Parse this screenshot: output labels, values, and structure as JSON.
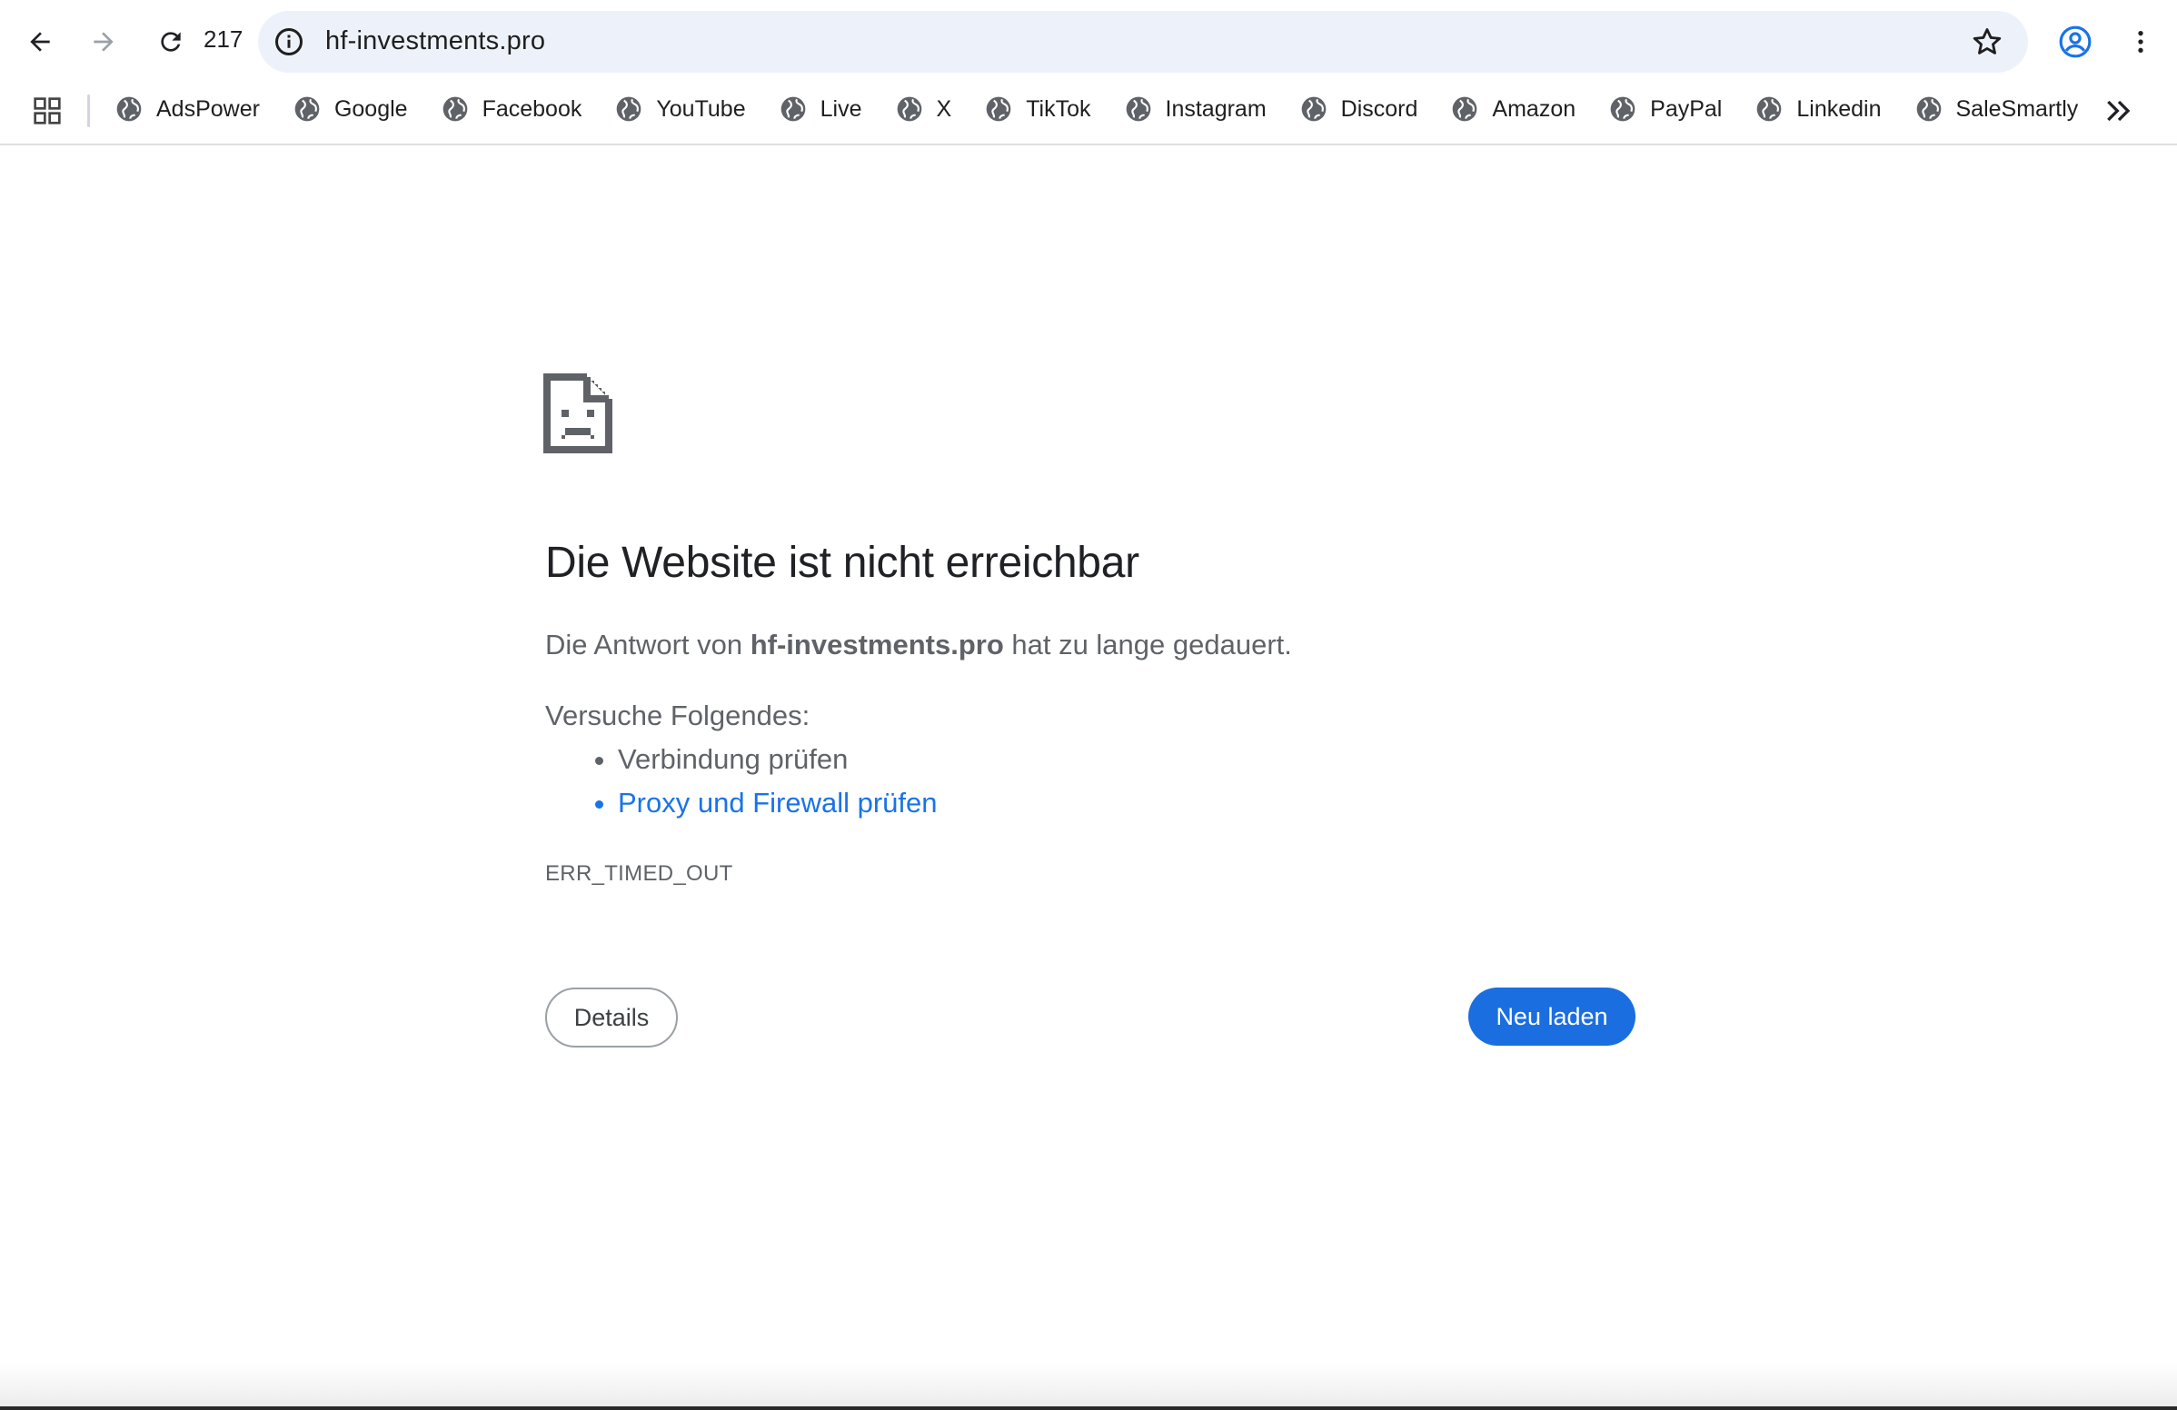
{
  "browser": {
    "tab_count": "217",
    "url": "hf-investments.pro",
    "icons": {
      "back": "back-arrow-icon",
      "forward": "forward-arrow-icon",
      "reload": "reload-icon",
      "site_info": "info-icon",
      "bookmark": "star-icon",
      "profile": "profile-icon",
      "menu": "kebab-menu-icon"
    }
  },
  "bookmarks": {
    "items": [
      {
        "label": "AdsPower"
      },
      {
        "label": "Google"
      },
      {
        "label": "Facebook"
      },
      {
        "label": "YouTube"
      },
      {
        "label": "Live"
      },
      {
        "label": "X"
      },
      {
        "label": "TikTok"
      },
      {
        "label": "Instagram"
      },
      {
        "label": "Discord"
      },
      {
        "label": "Amazon"
      },
      {
        "label": "PayPal"
      },
      {
        "label": "Linkedin"
      },
      {
        "label": "SaleSmartly"
      }
    ]
  },
  "error": {
    "title": "Die Website ist nicht erreichbar",
    "text_prefix": "Die Antwort von ",
    "host": "hf-investments.pro",
    "text_suffix": " hat zu lange gedauert.",
    "try_label": "Versuche Folgendes:",
    "suggestions": [
      "Verbindung prüfen",
      "Proxy und Firewall prüfen"
    ],
    "code": "ERR_TIMED_OUT",
    "details_button": "Details",
    "reload_button": "Neu laden"
  },
  "colors": {
    "accent": "#1b6ee0",
    "link": "#1a73e8",
    "omnibox_bg": "#edf2fa",
    "text_secondary": "#5f6368"
  }
}
